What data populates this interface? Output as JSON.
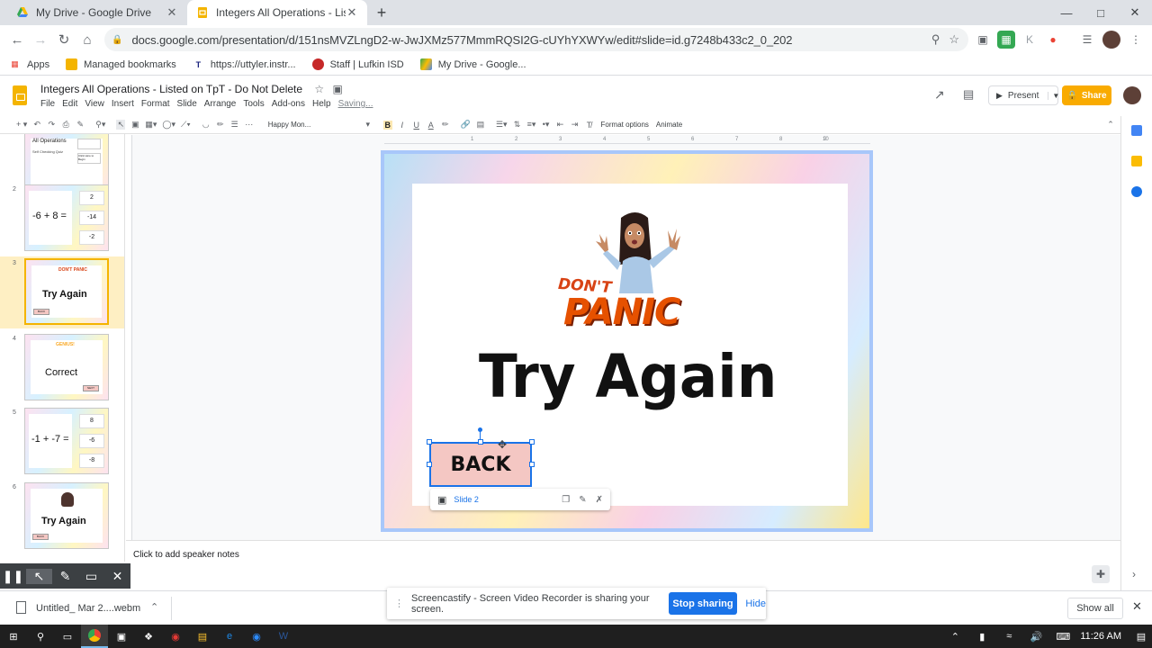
{
  "browser": {
    "tabs": [
      {
        "title": "My Drive - Google Drive",
        "close": "✕"
      },
      {
        "title": "Integers All Operations - Listed o",
        "close": "✕"
      }
    ],
    "new_tab": "+",
    "url": "docs.google.com/presentation/d/151nsMVZLngD2-w-JwJXMz577MmmRQSI2G-cUYhYXWYw/edit#slide=id.g7248b433c2_0_202",
    "bookmarks": [
      {
        "label": "Apps"
      },
      {
        "label": "Managed bookmarks"
      },
      {
        "label": "https://uttyler.instr..."
      },
      {
        "label": "Staff | Lufkin ISD"
      },
      {
        "label": "My Drive - Google..."
      }
    ]
  },
  "doc": {
    "title": "Integers All Operations - Listed on TpT - Do Not Delete",
    "menu": [
      "File",
      "Edit",
      "View",
      "Insert",
      "Format",
      "Slide",
      "Arrange",
      "Tools",
      "Add-ons",
      "Help"
    ],
    "saving": "Saving...",
    "present_label": "Present",
    "share_label": "Share"
  },
  "toolbar": {
    "font": "Happy Mon...",
    "format_options": "Format options",
    "animate": "Animate"
  },
  "ruler": [
    "1",
    "2",
    "3",
    "4",
    "5",
    "6",
    "7",
    "8",
    "9",
    "10"
  ],
  "filmstrip": {
    "slide1": {
      "line1": "All Operations",
      "line2": "Self Checking Quiz",
      "line3": "Click Here to Begin"
    },
    "slide2": {
      "num": "2",
      "equation": "-6 + 8 =",
      "options": [
        "2",
        "-14",
        "-2"
      ]
    },
    "slide3": {
      "num": "3",
      "text": "Try Again",
      "mini": "DON'T PANIC",
      "btn": "BACK"
    },
    "slide4": {
      "num": "4",
      "text": "Correct",
      "mini": "GENIUS!",
      "btn": "NEXT"
    },
    "slide5": {
      "num": "5",
      "equation": "-1 + -7 =",
      "options": [
        "8",
        "-6",
        "-8"
      ]
    },
    "slide6": {
      "num": "6",
      "text": "Try Again",
      "btn": "BACK"
    }
  },
  "slide": {
    "dont": "DON'T",
    "panic": "PANIC",
    "title": "Try Again",
    "button": "BACK",
    "link_label": "Slide 2"
  },
  "notes_placeholder": "Click to add speaker notes",
  "downloads": {
    "file": "Untitled_ Mar 2....webm",
    "show_all": "Show all"
  },
  "screencastify": {
    "message": "Screencastify - Screen Video Recorder is sharing your screen.",
    "stop": "Stop sharing",
    "hide": "Hide"
  },
  "taskbar": {
    "time": "11:26 AM"
  },
  "colors": {
    "accent": "#1a73e8",
    "share": "#f9ab00",
    "slide_button": "#f4c7c3",
    "selected_thumb": "#feefc3"
  }
}
